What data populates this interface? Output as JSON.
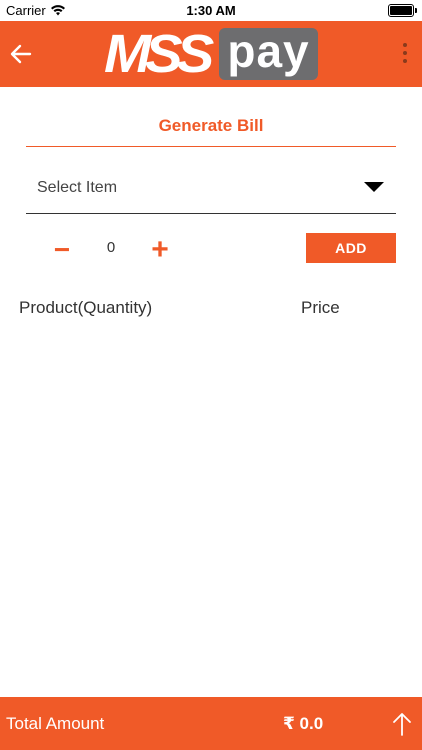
{
  "status_bar": {
    "carrier": "Carrier",
    "time": "1:30 AM"
  },
  "header": {
    "logo_left": "MSS",
    "logo_right": "pay"
  },
  "page": {
    "title": "Generate Bill"
  },
  "item_select": {
    "label": "Select Item"
  },
  "quantity": {
    "minus": "−",
    "value": "0",
    "plus": "+"
  },
  "add_button": {
    "label": "ADD"
  },
  "table": {
    "columns": [
      "Product(Quantity)",
      "Price"
    ]
  },
  "footer": {
    "total_label": "Total Amount",
    "total_value": "₹ 0.0"
  },
  "colors": {
    "accent": "#f05a28",
    "logo_box": "#6d6d6f"
  },
  "icons": {
    "back": "back-arrow-icon",
    "menu": "more-vertical-icon",
    "dropdown": "caret-down-icon",
    "footer": "arrow-up-icon"
  }
}
